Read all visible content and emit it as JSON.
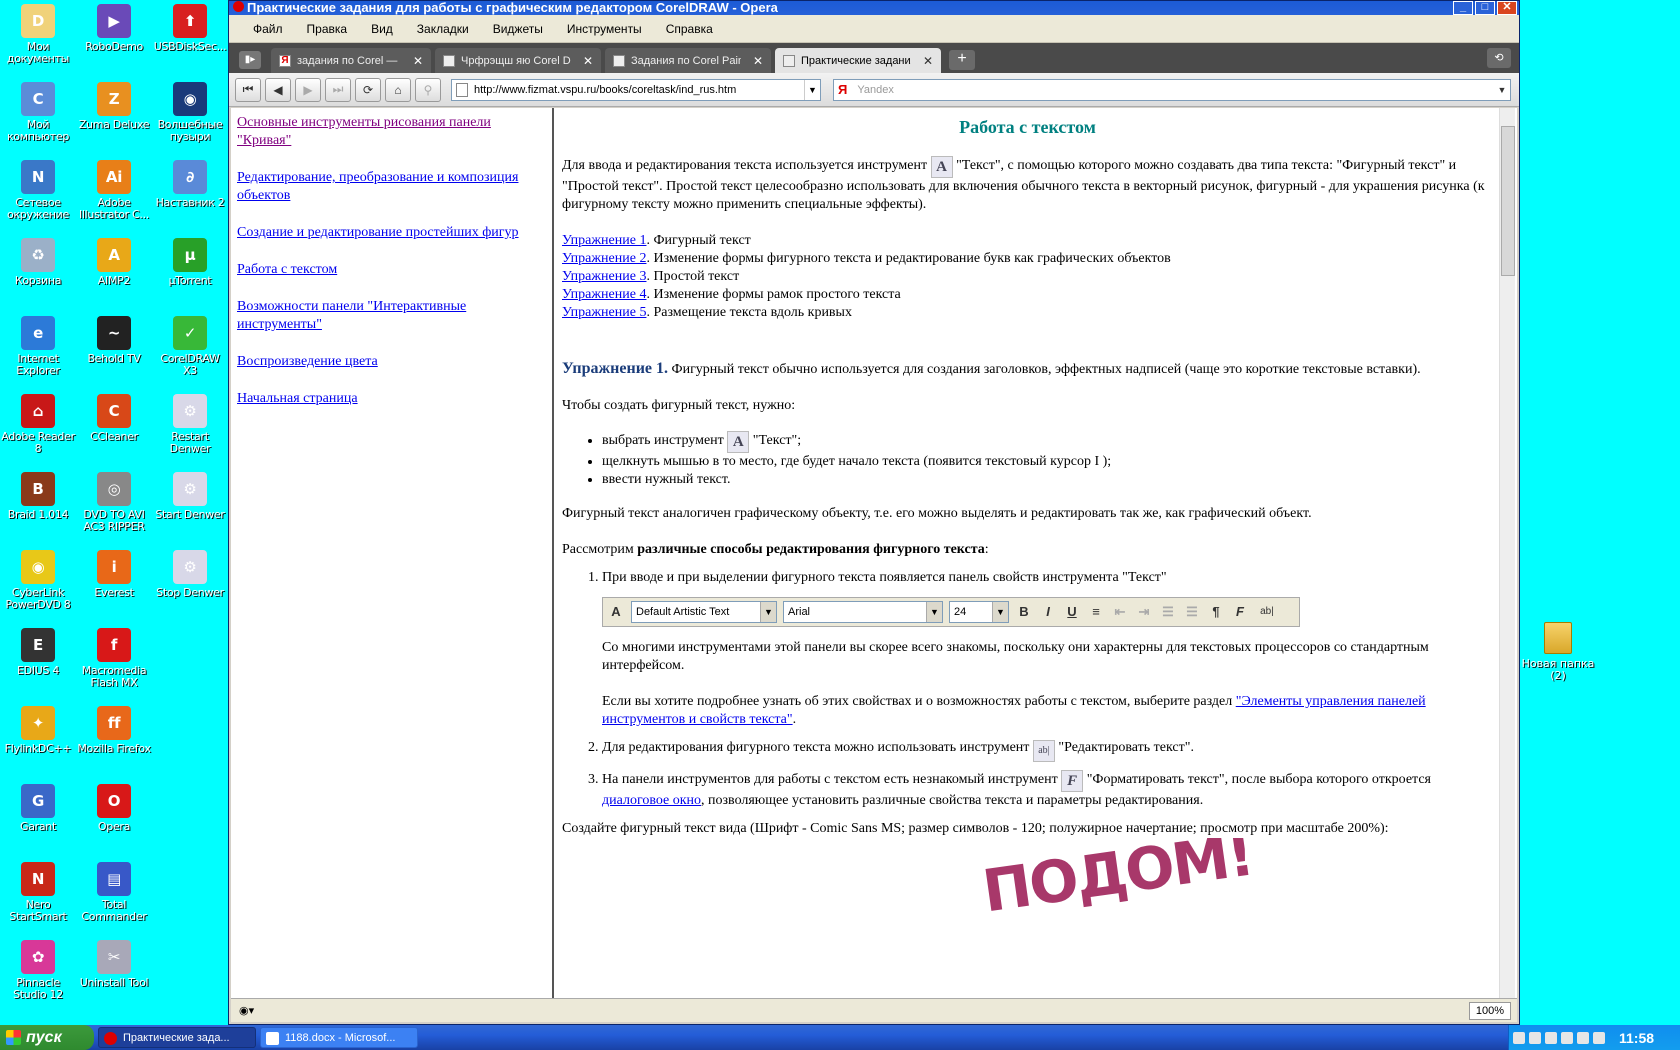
{
  "desktop": {
    "icons": [
      {
        "label": "Мои документы",
        "color": "#f0d27a",
        "glyph": "D"
      },
      {
        "label": "RoboDemo",
        "color": "#6a4ab8",
        "glyph": "▶"
      },
      {
        "label": "USBDiskSec...",
        "color": "#d82020",
        "glyph": "⬆"
      },
      {
        "label": "Мой компьютер",
        "color": "#5b8cd8",
        "glyph": "C"
      },
      {
        "label": "Zuma Deluxe",
        "color": "#e89020",
        "glyph": "Z"
      },
      {
        "label": "Волшебные пузыри",
        "color": "#1a3a7a",
        "glyph": "◉"
      },
      {
        "label": "Сетевое окружение",
        "color": "#3a78c8",
        "glyph": "N"
      },
      {
        "label": "Adobe Illustrator C...",
        "color": "#e87f18",
        "glyph": "Ai"
      },
      {
        "label": "Наставник 2",
        "color": "#5a8ad8",
        "glyph": "∂"
      },
      {
        "label": "Корзина",
        "color": "#9bb0c8",
        "glyph": "♻"
      },
      {
        "label": "AIMP2",
        "color": "#e8a818",
        "glyph": "A"
      },
      {
        "label": "µTorrent",
        "color": "#28a028",
        "glyph": "µ"
      },
      {
        "label": "Internet Explorer",
        "color": "#2c7ad8",
        "glyph": "e"
      },
      {
        "label": "Behold TV",
        "color": "#222222",
        "glyph": "~"
      },
      {
        "label": "CorelDRAW X3",
        "color": "#38b838",
        "glyph": "✓"
      },
      {
        "label": "Adobe Reader 8",
        "color": "#c81818",
        "glyph": "⌂"
      },
      {
        "label": "CCleaner",
        "color": "#d84818",
        "glyph": "C"
      },
      {
        "label": "Restart Denwer",
        "color": "#d8d8e8",
        "glyph": "⚙"
      },
      {
        "label": "Braid 1.014",
        "color": "#8a3a1a",
        "glyph": "B"
      },
      {
        "label": "DVD TO AVI AC3 RIPPER",
        "color": "#888888",
        "glyph": "◎"
      },
      {
        "label": "Start Denwer",
        "color": "#d8d8e8",
        "glyph": "⚙"
      },
      {
        "label": "CyberLink PowerDVD 8",
        "color": "#e8c818",
        "glyph": "◉"
      },
      {
        "label": "Everest",
        "color": "#e86818",
        "glyph": "i"
      },
      {
        "label": "Stop Denwer",
        "color": "#d8d8e8",
        "glyph": "⚙"
      },
      {
        "label": "EDIUS 4",
        "color": "#333333",
        "glyph": "E"
      },
      {
        "label": "Macromedia Flash MX",
        "color": "#d81818",
        "glyph": "f"
      },
      {
        "label": "",
        "color": "",
        "glyph": ""
      },
      {
        "label": "FlylinkDC++",
        "color": "#e8a818",
        "glyph": "✦"
      },
      {
        "label": "Mozilla Firefox",
        "color": "#e8681a",
        "glyph": "ff"
      },
      {
        "label": "",
        "color": "",
        "glyph": ""
      },
      {
        "label": "Garant",
        "color": "#3a68c8",
        "glyph": "G"
      },
      {
        "label": "Opera",
        "color": "#d81818",
        "glyph": "O"
      },
      {
        "label": "",
        "color": "",
        "glyph": ""
      },
      {
        "label": "Nero StartSmart",
        "color": "#c82818",
        "glyph": "N"
      },
      {
        "label": "Total Commander",
        "color": "#3858c8",
        "glyph": "▤"
      },
      {
        "label": "",
        "color": "",
        "glyph": ""
      },
      {
        "label": "Pinnacle Studio 12",
        "color": "#d83898",
        "glyph": "✿"
      },
      {
        "label": "Uninstall Tool",
        "color": "#a8a8b8",
        "glyph": "✂"
      }
    ],
    "right_icon": {
      "label": "Новая папка (2)"
    }
  },
  "window": {
    "title": "Практические задания для работы с графическим редактором CorelDRAW - Opera",
    "controls": {
      "minimize": "_",
      "maximize": "□",
      "close": "✕"
    }
  },
  "menu": [
    "Файл",
    "Правка",
    "Вид",
    "Закладки",
    "Виджеты",
    "Инструменты",
    "Справка"
  ],
  "tabs": [
    {
      "label": "задания по Corel — Ян...",
      "favicon": "Я",
      "active": false
    },
    {
      "label": "Чрфрэщш яю Corel Draw",
      "favicon": "",
      "active": false
    },
    {
      "label": "Задания по Corel Painte...",
      "favicon": "",
      "active": false
    },
    {
      "label": "Практические задания...",
      "favicon": "",
      "active": true
    }
  ],
  "newtab_label": "+",
  "nav": {
    "buttons": [
      {
        "name": "rewind-icon",
        "glyph": "⏮",
        "disabled": false
      },
      {
        "name": "back-icon",
        "glyph": "◀",
        "disabled": false
      },
      {
        "name": "forward-icon",
        "glyph": "▶",
        "disabled": true
      },
      {
        "name": "fast-forward-icon",
        "glyph": "⏭",
        "disabled": true
      },
      {
        "name": "reload-icon",
        "glyph": "⟳",
        "disabled": false
      },
      {
        "name": "home-icon",
        "glyph": "⌂",
        "disabled": false
      },
      {
        "name": "wand-icon",
        "glyph": "⚲",
        "disabled": true
      }
    ],
    "url": "http://www.fizmat.vspu.ru/books/coreltask/ind_rus.htm",
    "search_engine_logo": "Я",
    "search_placeholder": "Yandex"
  },
  "sidebar_links": [
    {
      "label": "Основные инструменты рисования панели \"Кривая\"",
      "visited": true
    },
    {
      "label": "Редактирование, преобразование и композиция объектов",
      "visited": false
    },
    {
      "label": "Создание и редактирование простейших фигур",
      "visited": false
    },
    {
      "label": "Работа с текстом",
      "visited": false
    },
    {
      "label": "Возможности панели \"Интерактивные инструменты\"",
      "visited": false
    },
    {
      "label": "Воспроизведение цвета",
      "visited": false
    },
    {
      "label": "Начальная страница",
      "visited": false
    }
  ],
  "page": {
    "heading": "Работа с текстом",
    "intro_before_icon": "Для ввода и редактирования текста используется инструмент",
    "intro_after_icon": "\"Текст\", с помощью которого можно создавать два типа текста: \"Фигурный текст\" и \"Простой текст\". Простой текст целесообразно использовать для включения обычного текста в векторный рисунок, фигурный - для украшения рисунка (к фигурному тексту можно применить специальные эффекты).",
    "exercises": [
      {
        "link": "Упражнение 1",
        "text": ". Фигурный текст"
      },
      {
        "link": "Упражнение 2",
        "text": ". Изменение формы фигурного текста и редактирование букв как графических объектов"
      },
      {
        "link": "Упражнение 3",
        "text": ". Простой текст"
      },
      {
        "link": "Упражнение 4",
        "text": ". Изменение формы рамок простого текста"
      },
      {
        "link": "Упражнение 5",
        "text": ". Размещение текста вдоль кривых"
      }
    ],
    "ex1_head": "Упражнение 1.",
    "ex1_text": "Фигурный текст обычно используется для создания заголовков, эффектных надписей (чаще это короткие текстовые вставки).",
    "how_to": "Чтобы создать фигурный текст, нужно:",
    "steps": [
      {
        "before": "выбрать инструмент",
        "after": "\"Текст\";"
      },
      {
        "before": "щелкнуть мышью в то место, где будет начало текста (появится текстовый курсор I );",
        "after": ""
      },
      {
        "before": "ввести нужный текст.",
        "after": ""
      }
    ],
    "analog": "Фигурный текст аналогичен графическому объекту, т.е. его можно выделять и редактировать так же, как графический объект.",
    "consider_pre": "Рассмотрим",
    "consider_bold": "различные способы редактирования фигурного текста",
    "consider_post": ":",
    "ol1": "При вводе и при выделении фигурного текста появляется панель свойств инструмента \"Текст\"",
    "toolbar": {
      "style": "Default Artistic Text",
      "font": "Arial",
      "size": "24",
      "b": "B",
      "i": "I",
      "u": "U",
      "para": "¶",
      "f": "F",
      "ab": "ab|"
    },
    "ol1_p1": "Со многими инструментами этой панели вы скорее всего знакомы, поскольку они характерны для текстовых процессоров со стандартным интерфейсом.",
    "ol1_p2_pre": "Если вы хотите подробнее узнать об этих свойствах и о возможностях работы с текстом, выберите раздел",
    "ol1_p2_link": "\"Элементы управления панелей инструментов и свойств текста\"",
    "ol1_p2_post": ".",
    "ol2_pre": "Для редактирования фигурного текста можно использовать инструмент",
    "ol2_icon": "ab|",
    "ol2_post": "\"Редактировать текст\".",
    "ol3_pre": "На панели инструментов для работы с текстом есть незнакомый инструмент",
    "ol3_icon": "F",
    "ol3_mid": "\"Форматировать текст\", после выбора которого откроется",
    "ol3_link": "диалоговое окно",
    "ol3_post": ", позволяющее установить различные свойства текста и параметры редактирования.",
    "create": "Создайте фигурный текст вида (Шрифт - Comic Sans MS; размер символов - 120; полужирное начертание; просмотр при масштабе 200%):",
    "art_text": "ПОДОМ!"
  },
  "status": {
    "zoom": "100%"
  },
  "taskbar": {
    "start": "пуск",
    "tasks": [
      {
        "label": "Практические зада...",
        "active": true
      },
      {
        "label": "1188.docx - Microsof...",
        "active": false
      }
    ],
    "clock": "11:58"
  }
}
